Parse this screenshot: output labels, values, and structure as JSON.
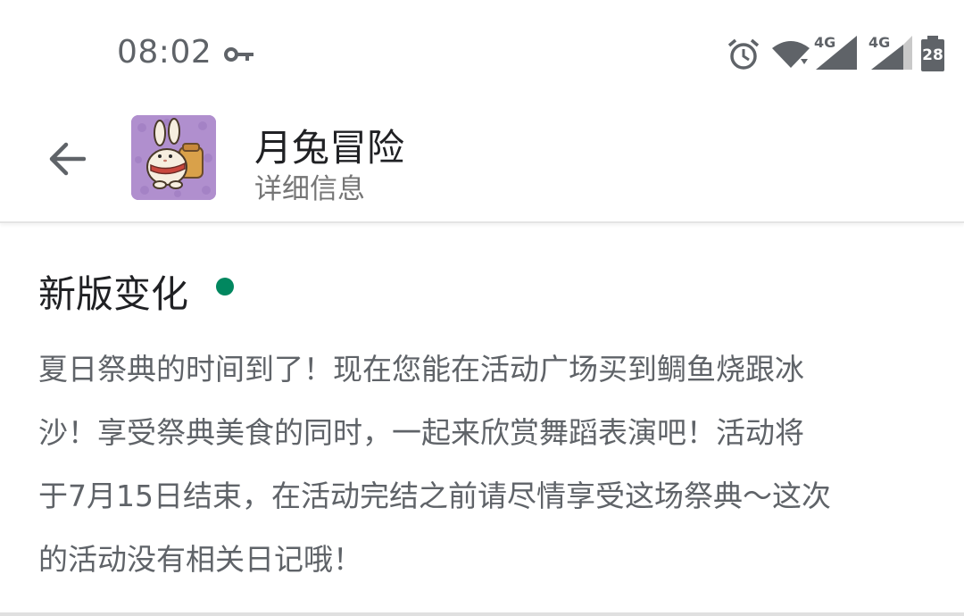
{
  "status_bar": {
    "time": "08:02",
    "network_label_1": "4G",
    "network_label_2": "4G",
    "battery_level": "28",
    "icons": [
      "key-icon",
      "alarm-icon",
      "wifi-icon",
      "signal-icon",
      "signal-icon",
      "battery-icon"
    ]
  },
  "header": {
    "back_icon": "arrow-left-icon",
    "app_name": "月兔冒险",
    "subtitle": "详细信息"
  },
  "whats_new": {
    "heading": "新版变化",
    "indicator_color": "#01875f",
    "body": "夏日祭典的时间到了！现在您能在活动广场买到鲷鱼烧跟冰\n沙！享受祭典美食的同时，一起来欣赏舞蹈表演吧！活动将\n于7月15日结束，在活动完结之前请尽情享受这场祭典～这次\n的活动没有相关日记哦！"
  },
  "colors": {
    "accent_green": "#01875f",
    "icon_background": "#b08fce",
    "secondary_text": "#5f6368"
  }
}
